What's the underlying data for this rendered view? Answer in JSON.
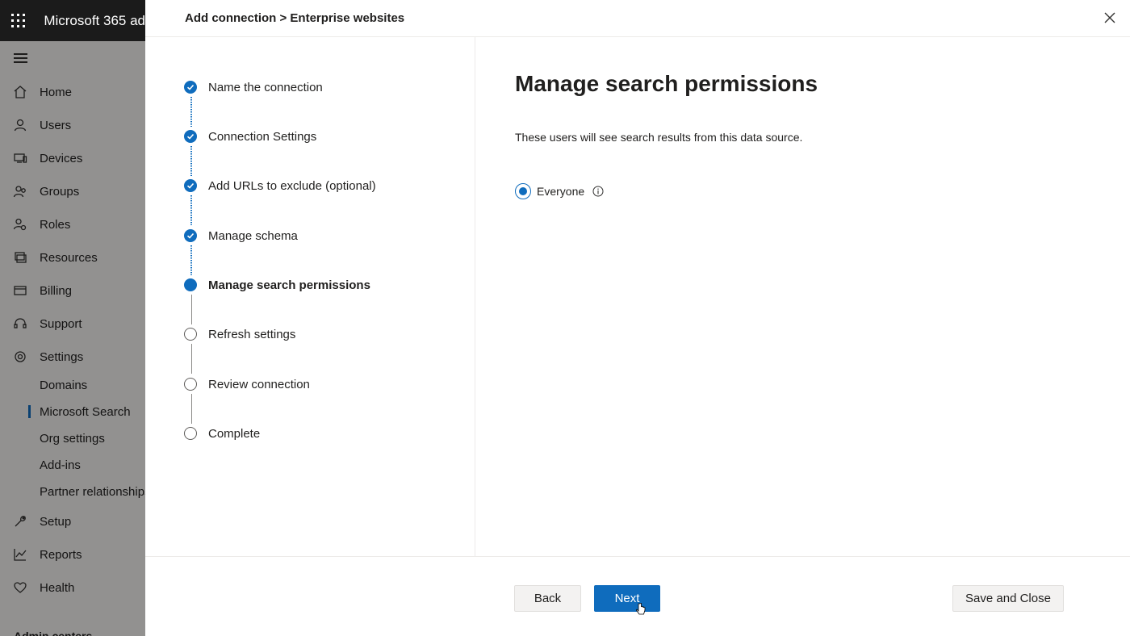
{
  "app": {
    "title": "Microsoft 365 ad"
  },
  "nav": {
    "items": [
      {
        "label": "Home",
        "icon": "home-icon"
      },
      {
        "label": "Users",
        "icon": "user-icon"
      },
      {
        "label": "Devices",
        "icon": "devices-icon"
      },
      {
        "label": "Groups",
        "icon": "groups-icon"
      },
      {
        "label": "Roles",
        "icon": "roles-icon"
      },
      {
        "label": "Resources",
        "icon": "resources-icon"
      },
      {
        "label": "Billing",
        "icon": "billing-icon"
      },
      {
        "label": "Support",
        "icon": "headset-icon"
      },
      {
        "label": "Settings",
        "icon": "gear-icon"
      }
    ],
    "settings_sub": [
      "Domains",
      "Microsoft Search",
      "Org settings",
      "Add-ins",
      "Partner relationships"
    ],
    "items_after": [
      {
        "label": "Setup",
        "icon": "wrench-icon"
      },
      {
        "label": "Reports",
        "icon": "chart-icon"
      },
      {
        "label": "Health",
        "icon": "heart-icon"
      }
    ],
    "section_label": "Admin centers"
  },
  "panel": {
    "breadcrumb": "Add connection > Enterprise websites",
    "steps": [
      {
        "label": "Name the connection",
        "state": "done"
      },
      {
        "label": "Connection Settings",
        "state": "done"
      },
      {
        "label": "Add URLs to exclude (optional)",
        "state": "done"
      },
      {
        "label": "Manage schema",
        "state": "done"
      },
      {
        "label": "Manage search permissions",
        "state": "current"
      },
      {
        "label": "Refresh settings",
        "state": "todo"
      },
      {
        "label": "Review connection",
        "state": "todo"
      },
      {
        "label": "Complete",
        "state": "todo"
      }
    ],
    "title": "Manage search permissions",
    "description": "These users will see search results from this data source.",
    "option": {
      "label": "Everyone",
      "selected": true
    },
    "buttons": {
      "back": "Back",
      "next": "Next",
      "save_close": "Save and Close"
    }
  },
  "colors": {
    "accent": "#0f6cbd",
    "topbar": "#1b1b1b"
  }
}
